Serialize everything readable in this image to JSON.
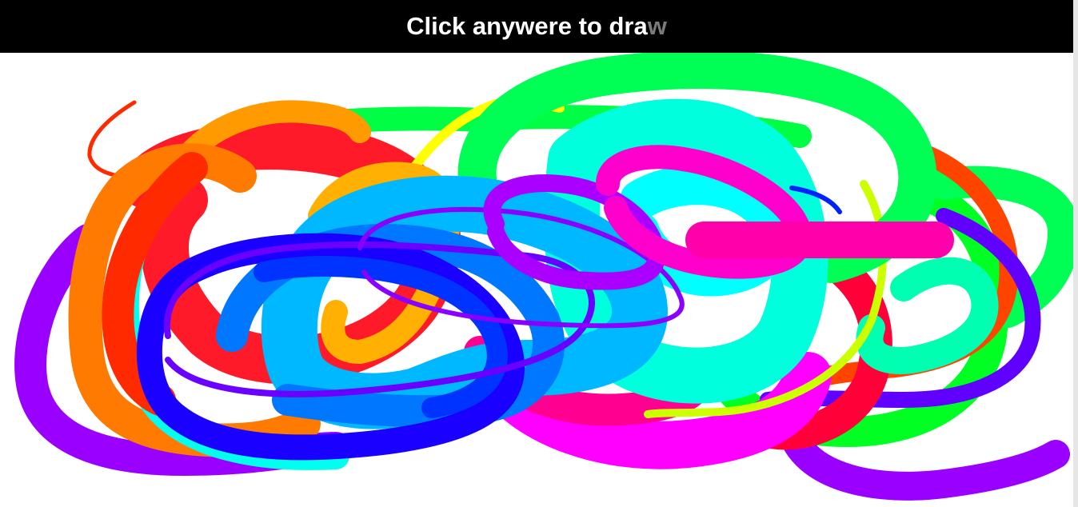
{
  "header": {
    "title_main": "Click anywere to dra",
    "title_tail": "w"
  },
  "canvas": {
    "background": "#ffffff",
    "stroke_colors": [
      "#ff1a00",
      "#ff7a00",
      "#ffa000",
      "#ffff00",
      "#00ff44",
      "#00ffcc",
      "#00ffff",
      "#00b8ff",
      "#0066ff",
      "#1a00ff",
      "#8a00ff",
      "#ff00ff",
      "#ff008c",
      "#ff0033"
    ],
    "stroke_count": 30
  }
}
